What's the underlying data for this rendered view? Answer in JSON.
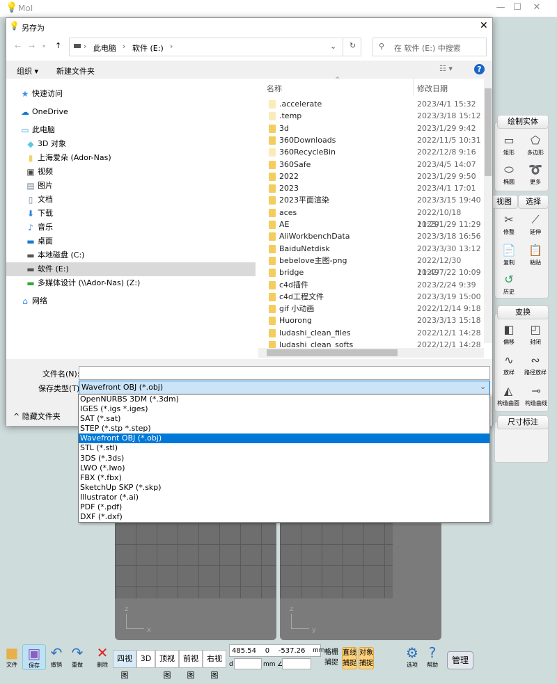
{
  "app": {
    "title": "MoI",
    "minimize": "—",
    "maximize": "☐",
    "close": "✕"
  },
  "viewports": {
    "left_axes": [
      "z",
      "x"
    ],
    "right_axes": [
      "z",
      "y"
    ]
  },
  "right_panel": {
    "draw_solid": "绘制实体",
    "draw_items": [
      "矩形",
      "多边形",
      "椭圆",
      "更多"
    ],
    "tabs": [
      "视图",
      "选择"
    ],
    "edit_items": [
      "修整",
      "延伸",
      "复制",
      "粘贴",
      "历史"
    ],
    "transform": "变换",
    "transform_items": [
      "偏移",
      "封闭",
      "放样",
      "路径放样",
      "构造曲面",
      "构造曲线"
    ],
    "dimension": "尺寸标注"
  },
  "toolbar": {
    "left": [
      {
        "label": "文件",
        "icon": "folder-icon"
      },
      {
        "label": "保存",
        "icon": "save-icon"
      },
      {
        "label": "撤销",
        "icon": "undo-icon"
      },
      {
        "label": "重做",
        "icon": "redo-icon"
      },
      {
        "label": "删除",
        "icon": "delete-icon"
      }
    ],
    "views": [
      "四视图",
      "3D",
      "顶视图",
      "前视图",
      "右视图"
    ],
    "coords": "485.54    0    -537.26",
    "unit": "mm",
    "d_label": "d",
    "angle_unit": "mm ∠",
    "grid_snap": "格栅捕捉",
    "line_snap": "直线捕捉",
    "object_snap": "对象捕捉",
    "options": "选项",
    "help": "帮助",
    "manage": "管理"
  },
  "dialog": {
    "title": "另存为",
    "close": "✕",
    "breadcrumb": [
      "此电脑",
      "软件 (E:)"
    ],
    "search_placeholder": "在 软件 (E:) 中搜索",
    "organize": "组织 ▾",
    "new_folder": "新建文件夹",
    "nav": [
      {
        "label": "快速访问",
        "icon": "star-icon",
        "level": 0
      },
      {
        "label": "OneDrive",
        "icon": "cloud-icon",
        "level": 0
      },
      {
        "label": "此电脑",
        "icon": "computer-icon",
        "level": 0
      },
      {
        "label": "3D 对象",
        "icon": "cube-icon",
        "level": 1
      },
      {
        "label": "上海爱朵 (Ador-Nas)",
        "icon": "network-folder-icon",
        "level": 1
      },
      {
        "label": "视频",
        "icon": "video-icon",
        "level": 1
      },
      {
        "label": "图片",
        "icon": "pictures-icon",
        "level": 1
      },
      {
        "label": "文档",
        "icon": "document-icon",
        "level": 1
      },
      {
        "label": "下载",
        "icon": "download-icon",
        "level": 1
      },
      {
        "label": "音乐",
        "icon": "music-icon",
        "level": 1
      },
      {
        "label": "桌面",
        "icon": "desktop-icon",
        "level": 1
      },
      {
        "label": "本地磁盘 (C:)",
        "icon": "drive-icon",
        "level": 1
      },
      {
        "label": "软件 (E:)",
        "icon": "drive-icon",
        "level": 1,
        "selected": true
      },
      {
        "label": "多媒体设计 (\\\\Ador-Nas) (Z:)",
        "icon": "network-drive-icon",
        "level": 1
      },
      {
        "label": "网络",
        "icon": "network-icon",
        "level": 0
      }
    ],
    "columns": {
      "name": "名称",
      "date": "修改日期"
    },
    "files": [
      {
        "name": ".accelerate",
        "date": "2023/4/1 15:32"
      },
      {
        "name": ".temp",
        "date": "2023/3/18 15:12"
      },
      {
        "name": "3d",
        "date": "2023/1/29 9:42"
      },
      {
        "name": "360Downloads",
        "date": "2022/11/5 10:31"
      },
      {
        "name": "360RecycleBin",
        "date": "2022/12/8 9:16"
      },
      {
        "name": "360Safe",
        "date": "2023/4/5 14:07"
      },
      {
        "name": "2022",
        "date": "2023/1/29 9:50"
      },
      {
        "name": "2023",
        "date": "2023/4/1 17:01"
      },
      {
        "name": "2023平面渲染",
        "date": "2023/3/15 19:40"
      },
      {
        "name": "aces",
        "date": "2022/10/18 11:29"
      },
      {
        "name": "AE",
        "date": "2023/1/29 11:29"
      },
      {
        "name": "AliWorkbenchData",
        "date": "2023/3/18 16:56"
      },
      {
        "name": "BaiduNetdisk",
        "date": "2023/3/30 13:12"
      },
      {
        "name": "bebelove主图-png",
        "date": "2022/12/30 11:49"
      },
      {
        "name": "bridge",
        "date": "2022/7/22 10:09"
      },
      {
        "name": "c4d插件",
        "date": "2023/2/24 9:39"
      },
      {
        "name": "c4d工程文件",
        "date": "2023/3/19 15:00"
      },
      {
        "name": "gif 小动画",
        "date": "2022/12/14 9:18"
      },
      {
        "name": "Huorong",
        "date": "2023/3/13 15:18"
      },
      {
        "name": "ludashi_clean_files",
        "date": "2022/12/1 14:28"
      },
      {
        "name": "ludashi_clean_softs",
        "date": "2022/12/1 14:28"
      }
    ],
    "filename_label": "文件名(N):",
    "filename_value": "",
    "filetype_label": "保存类型(T):",
    "filetype_value": "Wavefront OBJ (*.obj)",
    "hide_folders": "隐藏文件夹",
    "filetype_options": [
      "OpenNURBS 3DM (*.3dm)",
      "IGES (*.igs *.iges)",
      "SAT (*.sat)",
      "STEP (*.stp *.step)",
      "Wavefront OBJ (*.obj)",
      "STL (*.stl)",
      "3DS (*.3ds)",
      "LWO (*.lwo)",
      "FBX (*.fbx)",
      "SketchUp SKP (*.skp)",
      "Illustrator (*.ai)",
      "PDF (*.pdf)",
      "DXF (*.dxf)"
    ],
    "selected_option_index": 4
  },
  "colors": {
    "selection": "#0078d7",
    "folder": "#f5cd5e",
    "snap_active": "#fdd07a",
    "app_bg": "#cfdcdc"
  }
}
